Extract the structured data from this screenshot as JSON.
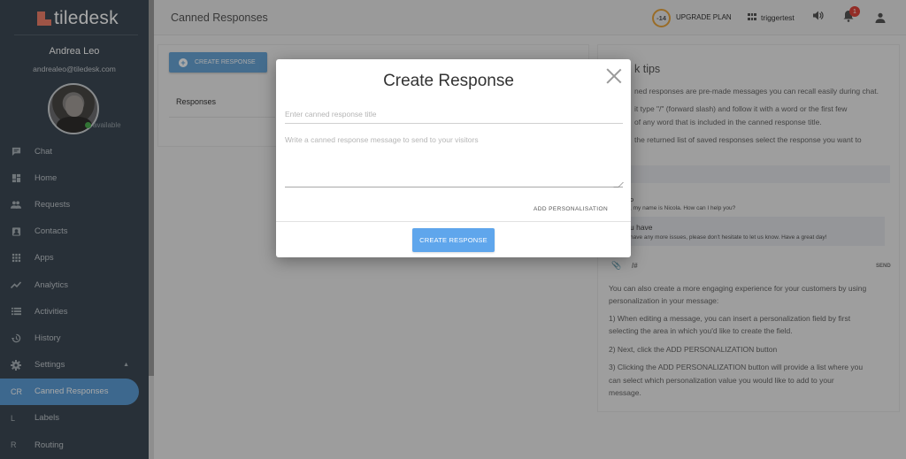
{
  "app": {
    "logo_text": "tiledesk"
  },
  "user": {
    "name": "Andrea Leo",
    "email": "andrealeo@tiledesk.com",
    "status": "available"
  },
  "sidebar": {
    "items": [
      {
        "label": "Chat",
        "icon": "chat-icon"
      },
      {
        "label": "Home",
        "icon": "dashboard-icon"
      },
      {
        "label": "Requests",
        "icon": "people-icon"
      },
      {
        "label": "Contacts",
        "icon": "contacts-icon"
      },
      {
        "label": "Apps",
        "icon": "apps-grid-icon"
      },
      {
        "label": "Analytics",
        "icon": "trending-icon"
      },
      {
        "label": "Activities",
        "icon": "list-icon"
      },
      {
        "label": "History",
        "icon": "history-icon"
      },
      {
        "label": "Settings",
        "icon": "gear-icon"
      }
    ],
    "sub_items": [
      {
        "abbr": "CR",
        "label": "Canned Responses",
        "active": true
      },
      {
        "abbr": "L",
        "label": "Labels"
      },
      {
        "abbr": "R",
        "label": "Routing"
      }
    ]
  },
  "header": {
    "page_title": "Canned Responses",
    "trial_days": "-14",
    "upgrade_label": "UPGRADE PLAN",
    "project_name": "triggertest",
    "notification_count": "1"
  },
  "main": {
    "create_button": "CREATE RESPONSE",
    "responses_header": "Responses"
  },
  "tips": {
    "title": "k tips",
    "lines": [
      "ned responses are pre-made messages you can recall easily during chat.",
      "it type \"/\" (forward slash) and follow it with a word or the first few",
      "of any word that is included in the canned response title.",
      "the returned list of saved responses select the response you want to"
    ],
    "demo_name": "o",
    "demo_message": ", my name is Nicola. How can I help you?",
    "demo_bubble_title": "u have",
    "demo_bubble_text": "have any more issues, please don't hesitate to let us know. Have a great day!",
    "send_label": "SEND",
    "paragraphs": [
      "You can also create a more engaging experience for your customers by using",
      "personalization in your message:",
      "1) When editing a message, you can insert a personalization field by first",
      "selecting the area in which you'd like to create the field.",
      "2) Next, click the ADD PERSONALIZATION button",
      "3) Clicking the ADD PERSONALIZATION button will provide a list where you",
      "can select which personalization value you would like to add to your",
      "message."
    ]
  },
  "modal": {
    "title": "Create Response",
    "title_placeholder": "Enter canned response title",
    "title_value": "",
    "message_placeholder": "Write a canned response message to send to your visitors",
    "message_value": "",
    "add_personalisation": "ADD PERSONALISATION",
    "create_button": "CREATE RESPONSE"
  },
  "colors": {
    "accent": "#5fa6ec",
    "sidebar_bg": "#3e4a55",
    "badge": "#e0443a",
    "logo": "#f0806b"
  }
}
